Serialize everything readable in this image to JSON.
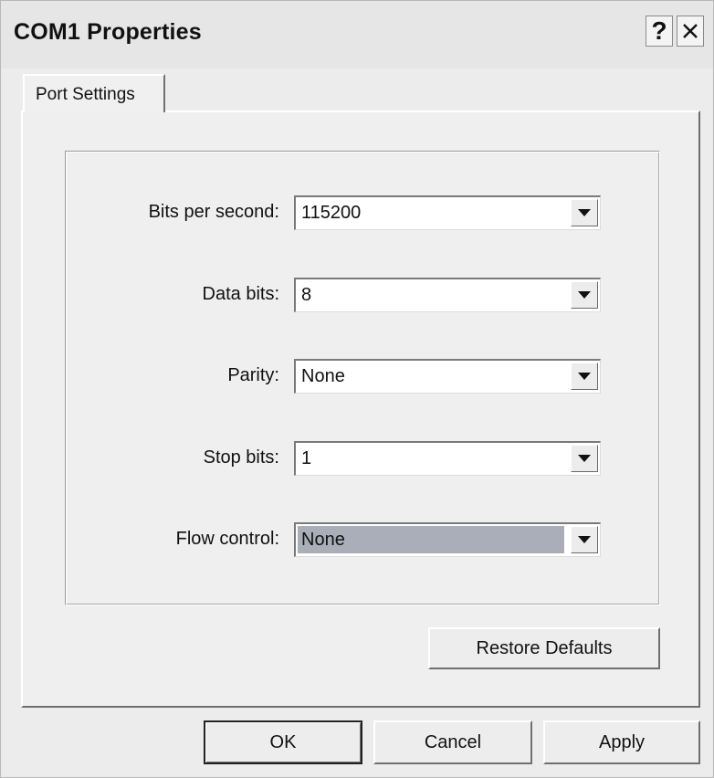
{
  "window": {
    "title": "COM1 Properties",
    "help_label": "?",
    "close_icon": "close-icon"
  },
  "tabs": [
    {
      "label": "Port Settings",
      "selected": true
    }
  ],
  "settings": {
    "bits_per_second": {
      "label": "Bits per second:",
      "value": "115200"
    },
    "data_bits": {
      "label": "Data bits:",
      "value": "8"
    },
    "parity": {
      "label": "Parity:",
      "value": "None"
    },
    "stop_bits": {
      "label": "Stop bits:",
      "value": "1"
    },
    "flow_control": {
      "label": "Flow control:",
      "value": "None",
      "focused": true
    }
  },
  "buttons": {
    "restore_defaults": "Restore Defaults",
    "ok": "OK",
    "cancel": "Cancel",
    "apply": "Apply"
  },
  "colors": {
    "face": "#ececec",
    "focus_highlight": "#a9aeb8"
  }
}
